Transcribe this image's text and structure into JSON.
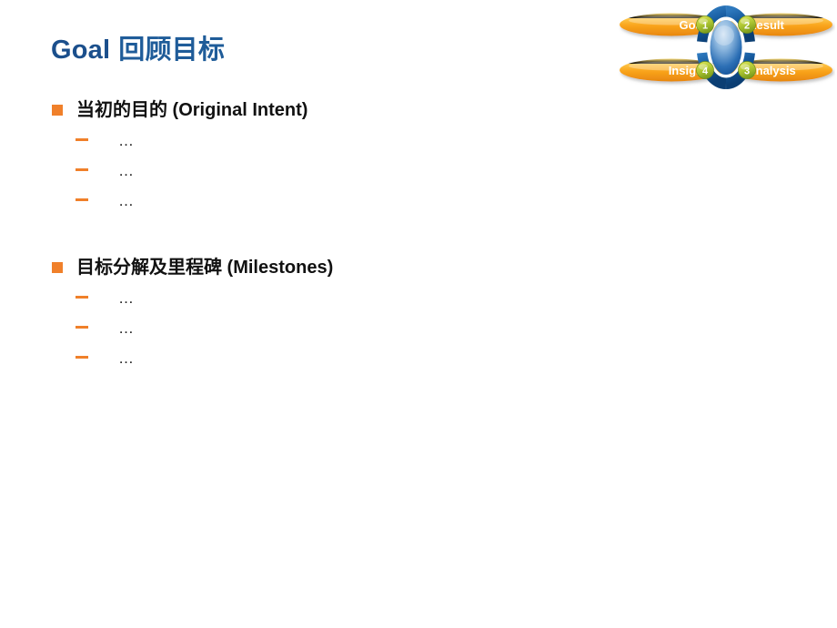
{
  "slide": {
    "title": {
      "english": "Goal",
      "chinese": "回顾目标"
    },
    "bullets": [
      {
        "text": "当初的目的 (Original Intent)",
        "marker": "orange-square",
        "sub_items": [
          {
            "text": "…",
            "marker": "orange-dash"
          },
          {
            "text": "…",
            "marker": "orange-dash"
          },
          {
            "text": "…",
            "marker": "orange-dash"
          }
        ]
      },
      {
        "text": "目标分解及里程碑 (Milestones)",
        "marker": "orange-square",
        "sub_items": [
          {
            "text": "…",
            "marker": "orange-dash"
          },
          {
            "text": "…",
            "marker": "orange-dash"
          },
          {
            "text": "…",
            "marker": "orange-dash"
          }
        ]
      }
    ]
  },
  "cycle_diagram": {
    "name": "grai-cycle-diagram",
    "nodes": [
      {
        "number": "1",
        "label": "Goal",
        "position": "top-left",
        "badge_side": "right"
      },
      {
        "number": "2",
        "label": "Result",
        "position": "top-right",
        "badge_side": "left"
      },
      {
        "number": "3",
        "label": "Analysis",
        "position": "bottom-right",
        "badge_side": "left"
      },
      {
        "number": "4",
        "label": "Insight",
        "position": "bottom-left",
        "badge_side": "right"
      }
    ],
    "colors": {
      "pill_light": "#FFD24A",
      "pill_mid": "#F9A11B",
      "pill_dark": "#E8870F",
      "badge_light": "#D9E04A",
      "badge_dark": "#8FB024",
      "ring_dark": "#0E4C8A",
      "ring_mid": "#1763A8",
      "core_light": "#9FC4E8",
      "core_dark": "#12529B",
      "label_text": "#FFFFFF"
    }
  },
  "theme": {
    "background": "#FFFFFF",
    "title_blue": "#1F5C99",
    "bullet_orange": "#F0802A",
    "body_text": "#111111"
  }
}
